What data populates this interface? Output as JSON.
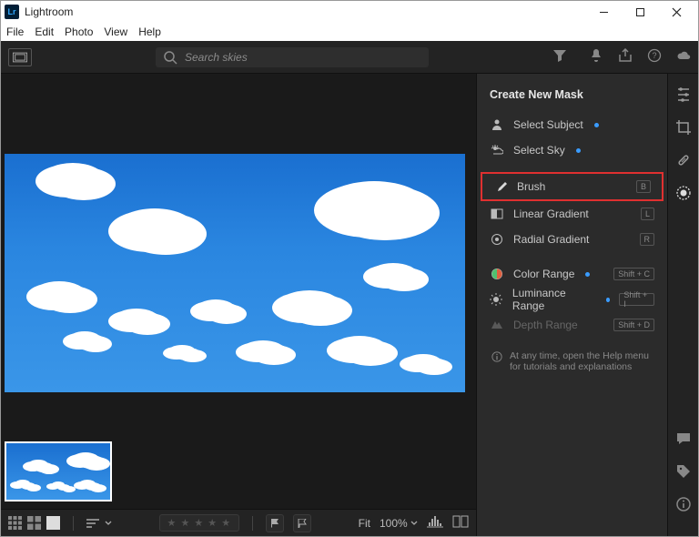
{
  "window": {
    "title": "Lightroom",
    "app_icon_text": "Lr"
  },
  "menubar": [
    "File",
    "Edit",
    "Photo",
    "View",
    "Help"
  ],
  "search": {
    "placeholder": "Search skies"
  },
  "mask_panel": {
    "title": "Create New Mask",
    "items": [
      {
        "label": "Select Subject",
        "dot": true,
        "kbd": ""
      },
      {
        "label": "Select Sky",
        "dot": true,
        "kbd": ""
      },
      {
        "label": "Brush",
        "dot": false,
        "kbd": "B",
        "highlight": true
      },
      {
        "label": "Linear Gradient",
        "dot": false,
        "kbd": "L"
      },
      {
        "label": "Radial Gradient",
        "dot": false,
        "kbd": "R"
      },
      {
        "label": "Color Range",
        "dot": true,
        "kbd": "Shift + C"
      },
      {
        "label": "Luminance Range",
        "dot": true,
        "kbd": "Shift + I"
      },
      {
        "label": "Depth Range",
        "dot": false,
        "kbd": "Shift + D",
        "disabled": true
      }
    ],
    "help_note": "At any time, open the Help menu for tutorials and explanations"
  },
  "bottombar": {
    "fit_label": "Fit",
    "zoom": "100%"
  }
}
